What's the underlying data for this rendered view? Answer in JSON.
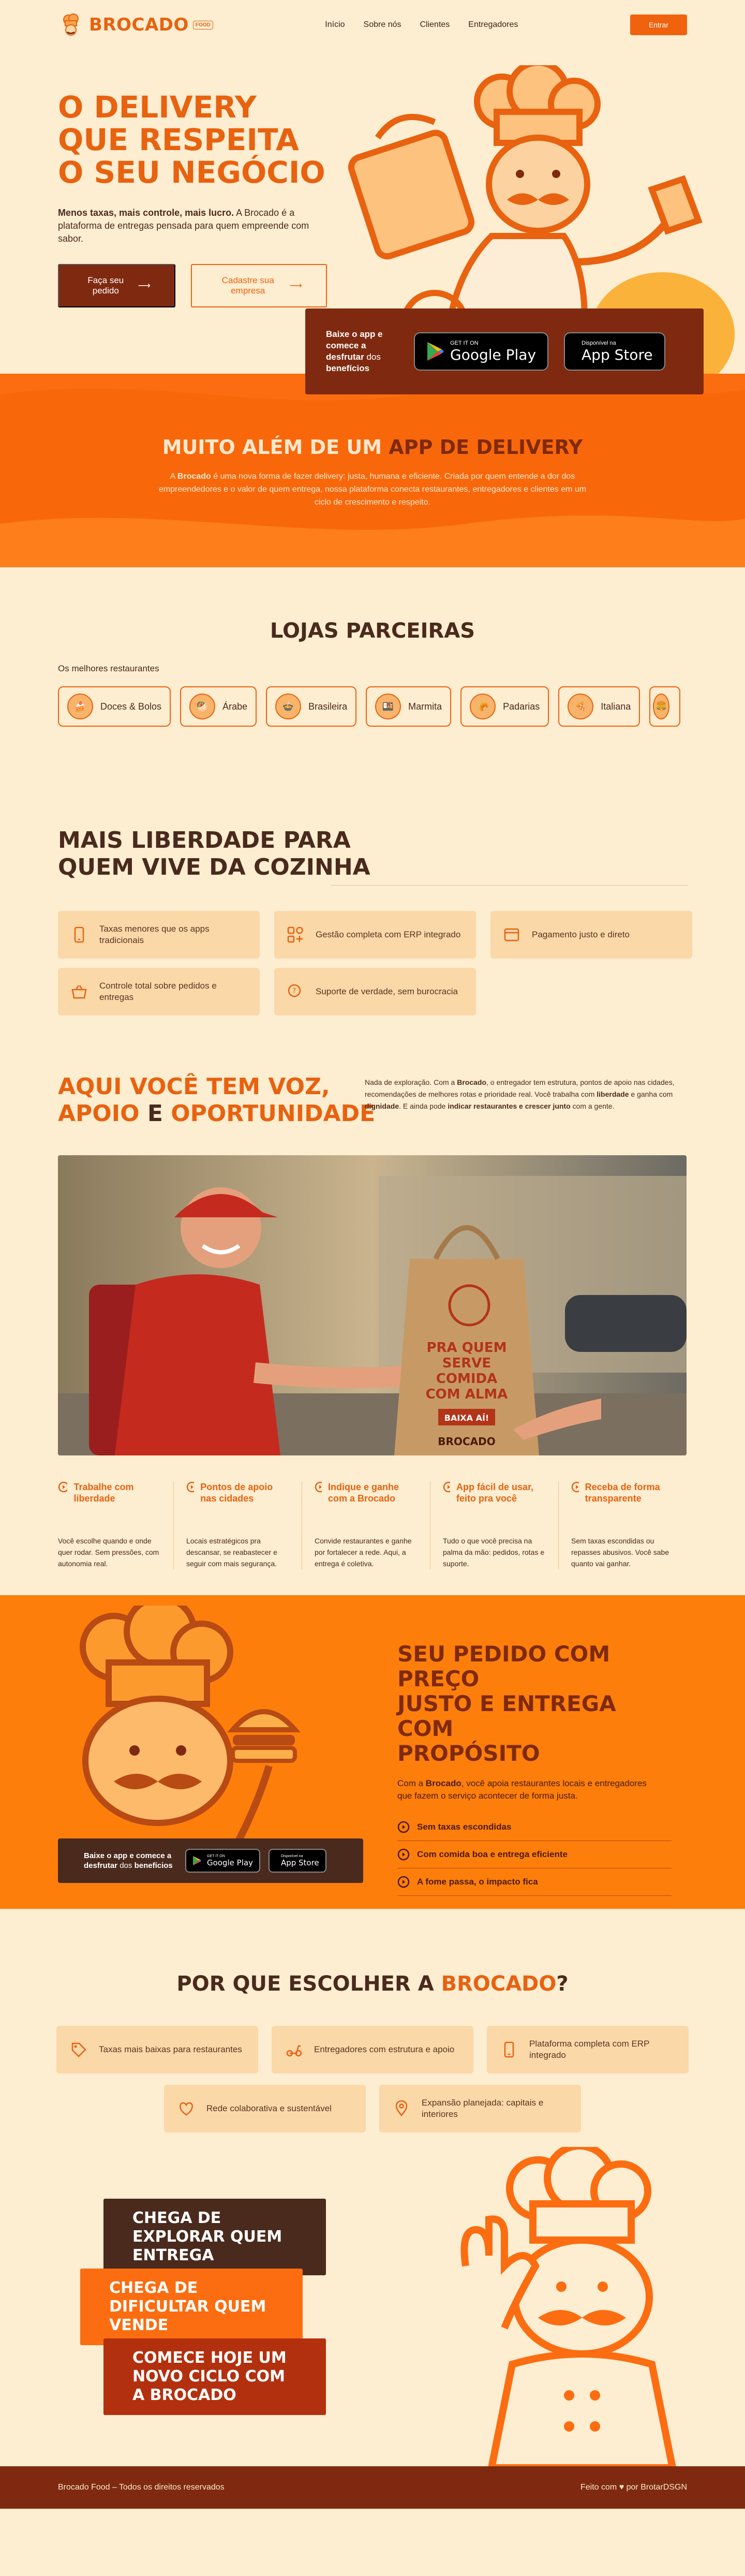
{
  "header": {
    "logo": "BROCADO",
    "logo_tag": "FOOD",
    "nav": [
      "Início",
      "Sobre nós",
      "Clientes",
      "Entregadores"
    ],
    "enter": "Entrar"
  },
  "hero": {
    "title": [
      "O DELIVERY",
      "QUE RESPEITA",
      "O SEU NEGÓCIO"
    ],
    "text_bold": "Menos taxas, mais controle, mais lucro.",
    "text": " A Brocado é a plataforma de entregas pensada para quem empreende com sabor.",
    "btn_order": "Faça seu pedido",
    "btn_register": "Cadastre sua empresa",
    "app_text_pre": "Baixe o app e comece a ",
    "app_text_bold": "desfrutar",
    "app_text_mid": " dos ",
    "app_text_bold2": "benefícios",
    "gplay_small": "GET IT ON",
    "gplay_big": "Google Play",
    "apple_small": "Disponível na",
    "apple_big": "App Store"
  },
  "band": {
    "title_a": "MUITO ALÉM DE UM ",
    "title_b": "APP DE DELIVERY",
    "text_pre": "A ",
    "text_bold": "Brocado",
    "text": " é uma nova forma de fazer delivery: justa, humana e eficiente. Criada por quem entende a dor dos empreendedores e o valor de quem entrega, nossa plataforma conecta restaurantes, entregadores e clientes em um ciclo de crescimento e respeito."
  },
  "partners": {
    "title": "LOJAS PARCEIRAS",
    "label": "Os melhores restaurantes",
    "chips": [
      "Doces & Bolos",
      "Árabe",
      "Brasileira",
      "Marmita",
      "Padarias",
      "Italiana",
      ""
    ]
  },
  "liberty": {
    "title": [
      "MAIS LIBERDADE PARA",
      "QUEM VIVE DA COZINHA"
    ],
    "items": [
      "Taxas menores que os apps tradicionais",
      "Gestão completa com ERP integrado",
      "Pagamento justo e direto",
      "Controle total sobre pedidos e entregas",
      "Suporte de verdade, sem burocracia"
    ]
  },
  "voice": {
    "title_l1": "AQUI VOCÊ TEM VOZ,",
    "title_l2_a": "APOIO ",
    "title_l2_b": "E ",
    "title_l2_c": "OPORTUNIDADE",
    "text_1": "Nada de exploração. Com a ",
    "text_b1": "Brocado",
    "text_2": ", o entregador tem estrutura, pontos de apoio nas cidades, recomendações de melhores rotas e prioridade real. Você trabalha com ",
    "text_b2": "liberdade",
    "text_3": " e ganha com ",
    "text_b3": "dignidade",
    "text_4": ". E ainda pode ",
    "text_b4": "indicar restaurantes e crescer junto",
    "text_5": " com a gente.",
    "bag_text": [
      "PRA QUEM",
      "SERVE",
      "COMIDA",
      "COM ALMA"
    ],
    "bag_btn": "BAIXA AÍ!",
    "bag_brand": "BROCADO",
    "cols": [
      {
        "h": "Trabalhe com liberdade",
        "t": "Você escolhe quando e onde quer rodar. Sem pressões, com autonomia real."
      },
      {
        "h": "Pontos de apoio nas cidades",
        "t": "Locais estratégicos pra descansar, se reabastecer e seguir com mais segurança."
      },
      {
        "h": "Indique e ganhe com a Brocado",
        "t": "Convide restaurantes e ganhe por fortalecer a rede. Aqui, a entrega é coletiva."
      },
      {
        "h": "App fácil de usar, feito pra você",
        "t": "Tudo o que você precisa na palma da mão: pedidos, rotas e suporte."
      },
      {
        "h": "Receba de forma transparente",
        "t": "Sem taxas escondidas ou repasses abusivos. Você sabe quanto vai ganhar."
      }
    ]
  },
  "order": {
    "title": [
      "SEU PEDIDO COM PREÇO",
      "JUSTO E ENTREGA COM",
      "PROPÓSITO"
    ],
    "text_1": "Com a ",
    "text_b": "Brocado",
    "text_2": ", você apoia restaurantes locais e entregadores que fazem o serviço acontecer de forma justa.",
    "checks": [
      "Sem taxas escondidas",
      "Com comida boa e entrega eficiente",
      "A fome passa, o impacto fica"
    ],
    "app_pre": "Baixe o app e comece a ",
    "app_b1": "desfrutar",
    "app_mid": " dos ",
    "app_b2": "benefícios",
    "gplay_small": "GET IT ON",
    "gplay_big": "Google Play",
    "apple_small": "Disponível na",
    "apple_big": "App Store"
  },
  "why": {
    "title_a": "POR QUE ESCOLHER A ",
    "title_b": "BROCADO",
    "title_c": "?",
    "items": [
      "Taxas mais baixas para restaurantes",
      "Entregadores com estrutura e apoio",
      "Plataforma completa com ERP integrado",
      "Rede colaborativa e sustentável",
      "Expansão planejada: capitais e interiores"
    ]
  },
  "tags": [
    "CHEGA DE EXPLORAR QUEM ENTREGA",
    "CHEGA DE DIFICULTAR QUEM VENDE",
    "COMECE HOJE UM NOVO CICLO COM A BROCADO"
  ],
  "footer": {
    "left": "Brocado Food – Todos os direitos reservados",
    "right_pre": "Feito com ",
    "right_post": " por ",
    "right_link": "BrotarDSGN"
  }
}
